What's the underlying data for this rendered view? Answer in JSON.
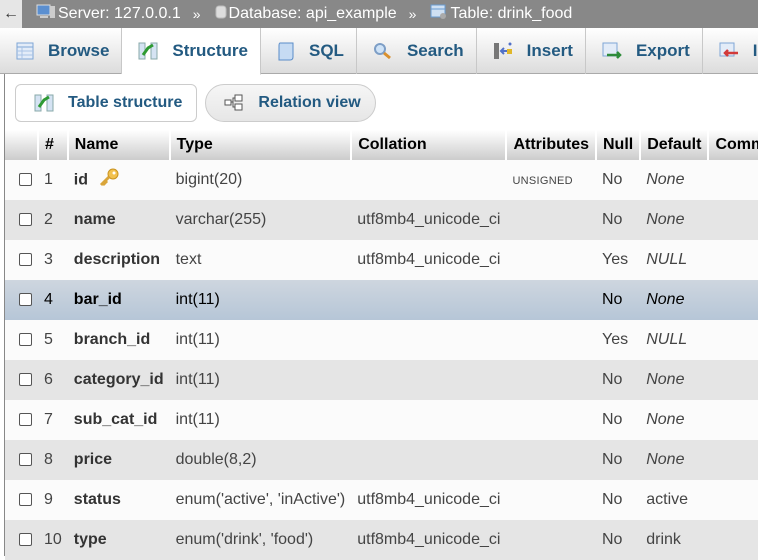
{
  "breadcrumb": {
    "back_label": "←",
    "items": [
      {
        "icon": "server-icon",
        "label": "Server: 127.0.0.1"
      },
      {
        "icon": "database-icon",
        "label": "Database: api_example"
      },
      {
        "icon": "table-icon",
        "label": "Table: drink_food"
      }
    ],
    "separator": "»"
  },
  "tabs": [
    {
      "icon": "browse-icon",
      "label": "Browse",
      "active": false
    },
    {
      "icon": "structure-icon",
      "label": "Structure",
      "active": true
    },
    {
      "icon": "sql-icon",
      "label": "SQL",
      "active": false
    },
    {
      "icon": "search-icon",
      "label": "Search",
      "active": false
    },
    {
      "icon": "insert-icon",
      "label": "Insert",
      "active": false
    },
    {
      "icon": "export-icon",
      "label": "Export",
      "active": false
    },
    {
      "icon": "import-icon",
      "label": "Import",
      "active": false
    }
  ],
  "subtabs": [
    {
      "icon": "structure-icon",
      "label": "Table structure"
    },
    {
      "icon": "relation-icon",
      "label": "Relation view"
    }
  ],
  "table": {
    "headers": [
      "",
      "#",
      "Name",
      "Type",
      "Collation",
      "Attributes",
      "Null",
      "Default",
      "Comments"
    ],
    "rows": [
      {
        "num": "1",
        "name": "id",
        "primary_key": true,
        "type": "bigint(20)",
        "collation": "",
        "attributes": "UNSIGNED",
        "null": "No",
        "default": "None",
        "default_italic": true
      },
      {
        "num": "2",
        "name": "name",
        "primary_key": false,
        "type": "varchar(255)",
        "collation": "utf8mb4_unicode_ci",
        "attributes": "",
        "null": "No",
        "default": "None",
        "default_italic": true
      },
      {
        "num": "3",
        "name": "description",
        "primary_key": false,
        "type": "text",
        "collation": "utf8mb4_unicode_ci",
        "attributes": "",
        "null": "Yes",
        "default": "NULL",
        "default_italic": true
      },
      {
        "num": "4",
        "name": "bar_id",
        "primary_key": false,
        "type": "int(11)",
        "collation": "",
        "attributes": "",
        "null": "No",
        "default": "None",
        "default_italic": true,
        "hovered": true
      },
      {
        "num": "5",
        "name": "branch_id",
        "primary_key": false,
        "type": "int(11)",
        "collation": "",
        "attributes": "",
        "null": "Yes",
        "default": "NULL",
        "default_italic": true
      },
      {
        "num": "6",
        "name": "category_id",
        "primary_key": false,
        "type": "int(11)",
        "collation": "",
        "attributes": "",
        "null": "No",
        "default": "None",
        "default_italic": true
      },
      {
        "num": "7",
        "name": "sub_cat_id",
        "primary_key": false,
        "type": "int(11)",
        "collation": "",
        "attributes": "",
        "null": "No",
        "default": "None",
        "default_italic": true
      },
      {
        "num": "8",
        "name": "price",
        "primary_key": false,
        "type": "double(8,2)",
        "collation": "",
        "attributes": "",
        "null": "No",
        "default": "None",
        "default_italic": true
      },
      {
        "num": "9",
        "name": "status",
        "primary_key": false,
        "type": "enum('active', 'inActive')",
        "collation": "utf8mb4_unicode_ci",
        "attributes": "",
        "null": "No",
        "default": "active",
        "default_italic": false
      },
      {
        "num": "10",
        "name": "type",
        "primary_key": false,
        "type": "enum('drink', 'food')",
        "collation": "utf8mb4_unicode_ci",
        "attributes": "",
        "null": "No",
        "default": "drink",
        "default_italic": false
      }
    ]
  },
  "colors": {
    "topbar": "#888888",
    "link": "#235a81",
    "row_even": "#e5e5e5",
    "row_hover": "#c1cedb"
  }
}
